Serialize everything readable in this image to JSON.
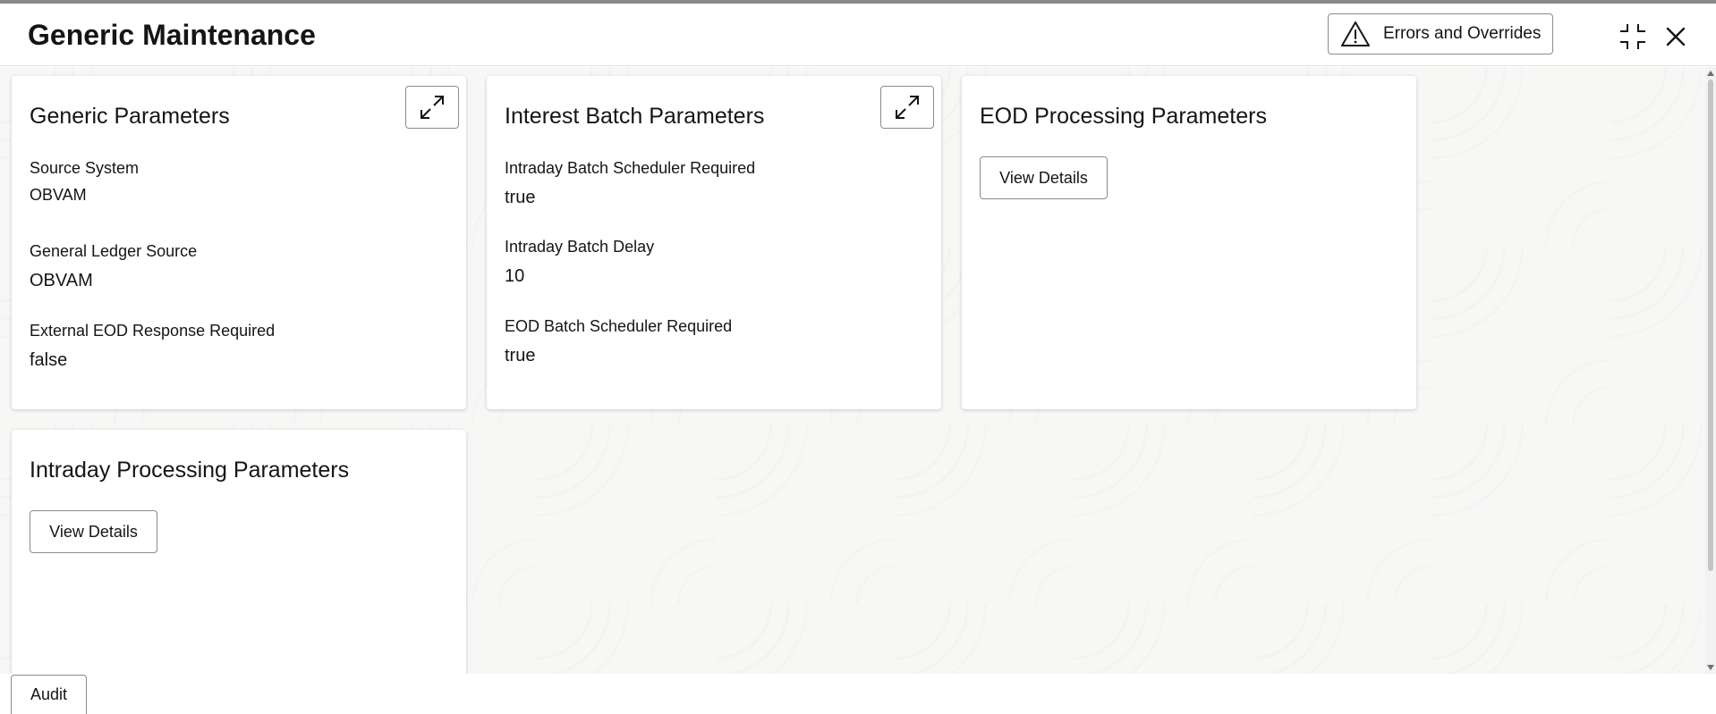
{
  "header": {
    "title": "Generic Maintenance",
    "errors_button_label": "Errors and Overrides"
  },
  "cards": {
    "generic": {
      "title": "Generic Parameters",
      "fields": [
        {
          "label": "Source System",
          "value": "OBVAM"
        },
        {
          "label": "General Ledger Source",
          "value": "OBVAM"
        },
        {
          "label": "External EOD Response Required",
          "value": "false"
        }
      ]
    },
    "interest": {
      "title": "Interest Batch Parameters",
      "fields": [
        {
          "label": "Intraday Batch Scheduler Required",
          "value": "true"
        },
        {
          "label": "Intraday Batch Delay",
          "value": "10"
        },
        {
          "label": "EOD Batch Scheduler Required",
          "value": "true"
        }
      ]
    },
    "eod": {
      "title": "EOD Processing Parameters",
      "button_label": "View Details"
    },
    "intraday": {
      "title": "Intraday Processing Parameters",
      "button_label": "View Details"
    }
  },
  "footer": {
    "audit_label": "Audit"
  },
  "icons": {
    "warning": "warning-icon",
    "compress": "compress-icon",
    "close": "close-icon",
    "expand": "expand-icon"
  }
}
